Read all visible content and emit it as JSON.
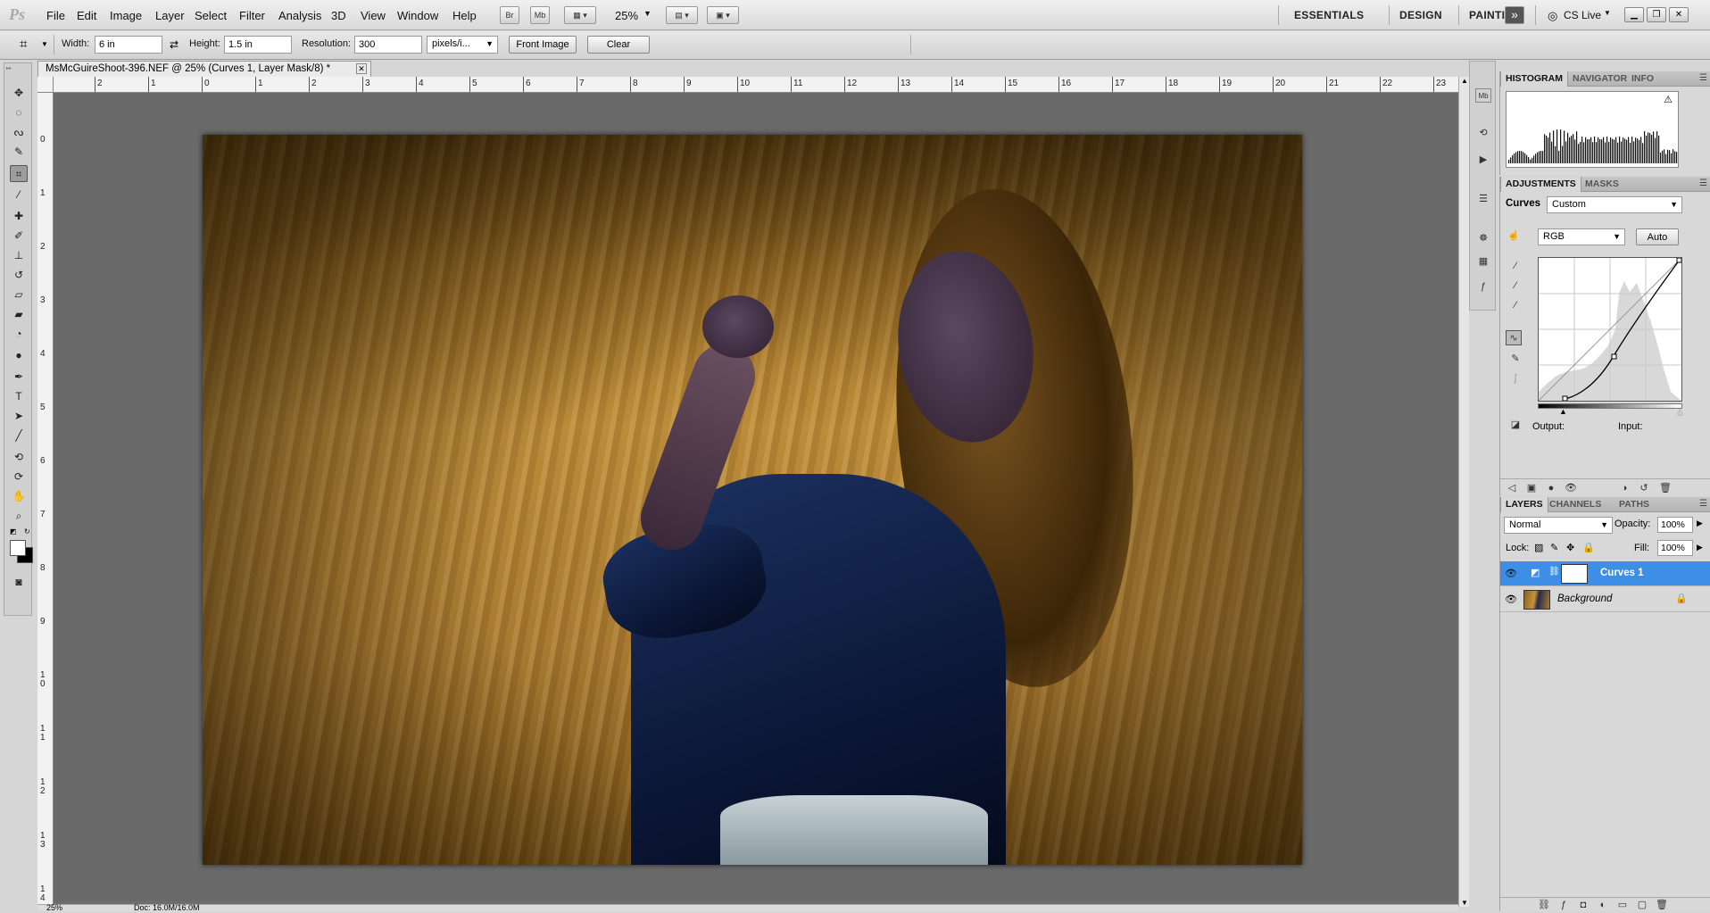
{
  "menubar": {
    "logo": "Ps",
    "items": [
      "File",
      "Edit",
      "Image",
      "Layer",
      "Select",
      "Filter",
      "Analysis",
      "3D",
      "View",
      "Window",
      "Help"
    ],
    "bridge_label": "Br",
    "minibridge_label": "Mb",
    "zoom": "25%",
    "workspaces": [
      "ESSENTIALS",
      "DESIGN",
      "PAINTING"
    ],
    "more_workspaces": "»",
    "cs_live": "CS Live"
  },
  "options": {
    "width_label": "Width:",
    "width_value": "6 in",
    "height_label": "Height:",
    "height_value": "1.5 in",
    "resolution_label": "Resolution:",
    "resolution_value": "300",
    "resolution_unit": "pixels/i...",
    "front_image": "Front Image",
    "clear": "Clear"
  },
  "document": {
    "tab_title": "MsMcGuireShoot-396.NEF @ 25% (Curves 1, Layer Mask/8) *",
    "ruler_h": [
      "2",
      "1",
      "0",
      "1",
      "2",
      "3",
      "4",
      "5",
      "6",
      "7",
      "8",
      "9",
      "10",
      "11",
      "12",
      "13",
      "14",
      "15",
      "16",
      "17",
      "18",
      "19",
      "20",
      "21",
      "22",
      "23"
    ],
    "ruler_v": [
      "0",
      "1",
      "2",
      "3",
      "4",
      "5",
      "6",
      "7",
      "8",
      "9",
      "10",
      "11",
      "12",
      "13",
      "14"
    ],
    "status_zoom": "25%",
    "status_doc": "Doc: 16.0M/16.0M"
  },
  "panels": {
    "histogram_tabs": [
      "HISTOGRAM",
      "NAVIGATOR",
      "INFO"
    ],
    "adjust_tabs": [
      "ADJUSTMENTS",
      "MASKS"
    ],
    "curves_label": "Curves",
    "preset": "Custom",
    "channel": "RGB",
    "auto": "Auto",
    "output_label": "Output:",
    "input_label": "Input:",
    "layers_tabs": [
      "LAYERS",
      "CHANNELS",
      "PATHS"
    ],
    "blend_mode": "Normal",
    "opacity_label": "Opacity:",
    "opacity_value": "100%",
    "lock_label": "Lock:",
    "fill_label": "Fill:",
    "fill_value": "100%",
    "layers": [
      {
        "name": "Curves 1",
        "selected": true
      },
      {
        "name": "Background",
        "selected": false
      }
    ]
  },
  "colors": {
    "selection": "#3d8ee6",
    "canvas_bg": "#6a6a6a"
  }
}
